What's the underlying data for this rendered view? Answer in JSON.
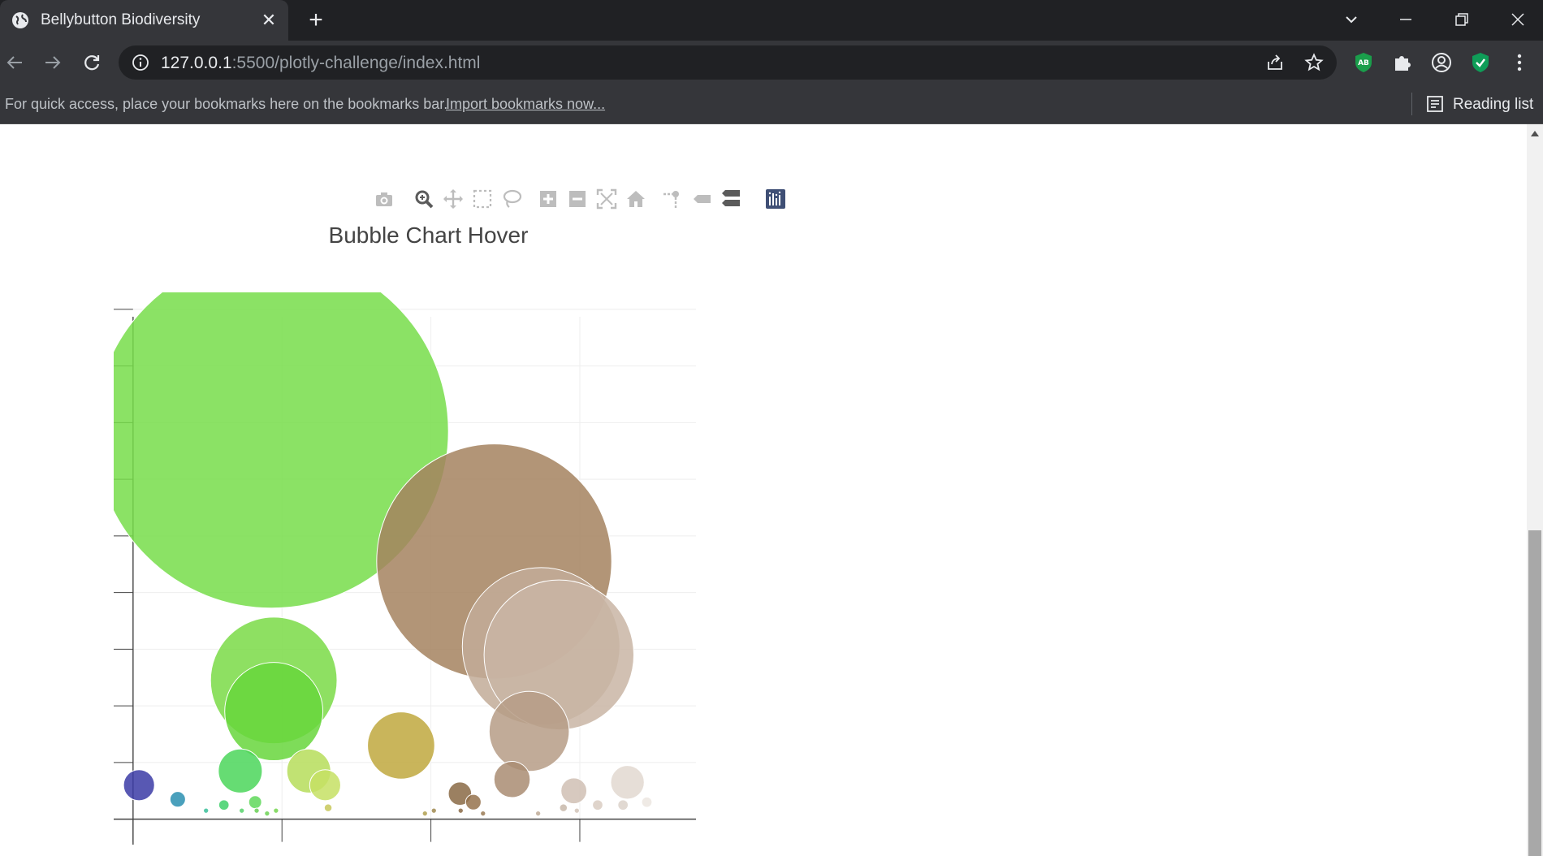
{
  "browser": {
    "tab_title": "Bellybutton Biodiversity",
    "url_host": "127.0.0.1",
    "url_path": ":5500/plotly-challenge/index.html",
    "bookmarks_hint": "For quick access, place your bookmarks here on the bookmarks bar.",
    "bookmarks_import": "Import bookmarks now...",
    "reading_list": "Reading list",
    "extension_ab_label": "AB"
  },
  "modebar": {
    "buttons": [
      "camera-icon",
      "zoom-icon",
      "pan-icon",
      "box-select-icon",
      "lasso-select-icon",
      "zoom-in-icon",
      "zoom-out-icon",
      "autoscale-icon",
      "reset-axes-icon",
      "spike-lines-icon",
      "compare-hover-icon",
      "closest-hover-icon",
      "plotly-logo-icon"
    ]
  },
  "chart_data": {
    "type": "scatter",
    "title": "Bubble Chart Hover",
    "xlabel": "",
    "ylabel": "",
    "xlim": [
      -130,
      3780
    ],
    "ylim": [
      -9,
      186
    ],
    "x_ticks": [
      "0",
      "1000",
      "2000",
      "3000"
    ],
    "y_ticks": [
      "0",
      "20",
      "40",
      "60",
      "80",
      "100",
      "120",
      "140",
      "160",
      "180"
    ],
    "grid": true,
    "points": [
      {
        "x": 40,
        "y": 12,
        "size": 12,
        "color": "#3b3ba6"
      },
      {
        "x": 300,
        "y": 7,
        "size": 6,
        "color": "#2a8fb0"
      },
      {
        "x": 490,
        "y": 3,
        "size": 2,
        "color": "#3abf9a"
      },
      {
        "x": 610,
        "y": 5,
        "size": 4,
        "color": "#3fd06a"
      },
      {
        "x": 720,
        "y": 17,
        "size": 17,
        "color": "#4bd65a"
      },
      {
        "x": 730,
        "y": 3,
        "size": 2,
        "color": "#56d26b"
      },
      {
        "x": 820,
        "y": 6,
        "size": 5,
        "color": "#5fd85a"
      },
      {
        "x": 830,
        "y": 3,
        "size": 2,
        "color": "#67d054"
      },
      {
        "x": 900,
        "y": 2,
        "size": 2,
        "color": "#6cd254"
      },
      {
        "x": 960,
        "y": 3,
        "size": 2,
        "color": "#76d650"
      },
      {
        "x": 930,
        "y": 137,
        "size": 137,
        "color": "#77dd4a"
      },
      {
        "x": 945,
        "y": 49,
        "size": 49,
        "color": "#7ada46"
      },
      {
        "x": 945,
        "y": 38,
        "size": 38,
        "color": "#67d63c"
      },
      {
        "x": 1180,
        "y": 17,
        "size": 17,
        "color": "#b6dd5a"
      },
      {
        "x": 1290,
        "y": 12,
        "size": 12,
        "color": "#c6e064"
      },
      {
        "x": 1310,
        "y": 4,
        "size": 3,
        "color": "#c8c85a"
      },
      {
        "x": 1800,
        "y": 26,
        "size": 26,
        "color": "#bfa83e"
      },
      {
        "x": 1960,
        "y": 2,
        "size": 2,
        "color": "#b0a050"
      },
      {
        "x": 2020,
        "y": 3,
        "size": 2,
        "color": "#a08a50"
      },
      {
        "x": 2195,
        "y": 9,
        "size": 9,
        "color": "#8a6a45"
      },
      {
        "x": 2200,
        "y": 3,
        "size": 2,
        "color": "#8a6a45"
      },
      {
        "x": 2285,
        "y": 6,
        "size": 6,
        "color": "#95724c"
      },
      {
        "x": 2350,
        "y": 2,
        "size": 2,
        "color": "#9a7a55"
      },
      {
        "x": 2425,
        "y": 91,
        "size": 91,
        "color": "#a5835f"
      },
      {
        "x": 2545,
        "y": 14,
        "size": 14,
        "color": "#a98c72"
      },
      {
        "x": 2660,
        "y": 31,
        "size": 31,
        "color": "#b69c86"
      },
      {
        "x": 2740,
        "y": 61,
        "size": 61,
        "color": "#c2ab98"
      },
      {
        "x": 2860,
        "y": 58,
        "size": 58,
        "color": "#c9b5a5"
      },
      {
        "x": 2720,
        "y": 2,
        "size": 2,
        "color": "#c0ab98"
      },
      {
        "x": 2890,
        "y": 4,
        "size": 3,
        "color": "#c8b8aa"
      },
      {
        "x": 2960,
        "y": 10,
        "size": 10,
        "color": "#d0c0b4"
      },
      {
        "x": 2980,
        "y": 3,
        "size": 2,
        "color": "#d2c4b8"
      },
      {
        "x": 3120,
        "y": 5,
        "size": 4,
        "color": "#d9ccc2"
      },
      {
        "x": 3290,
        "y": 5,
        "size": 4,
        "color": "#dcd2ca"
      },
      {
        "x": 3320,
        "y": 13,
        "size": 13,
        "color": "#e2d8d0"
      },
      {
        "x": 3450,
        "y": 6,
        "size": 4,
        "color": "#ece6e0"
      }
    ]
  }
}
